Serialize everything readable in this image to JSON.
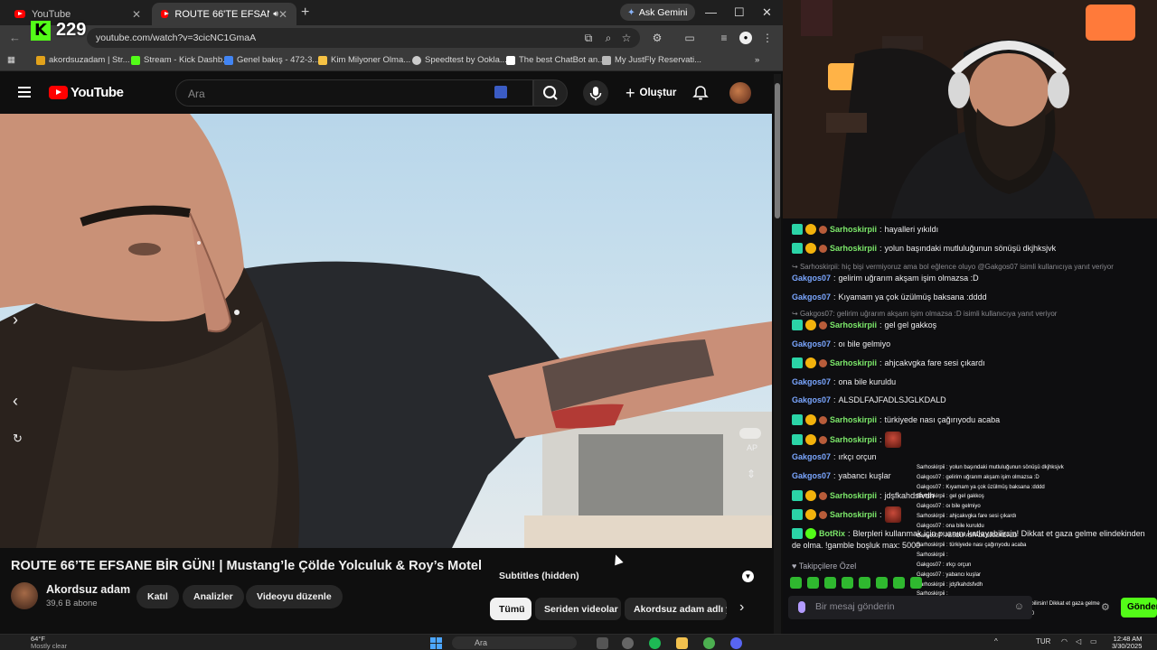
{
  "browser": {
    "tabs": [
      {
        "label": "YouTube"
      },
      {
        "label": "ROUTE 66'TE EFSANE BİR G"
      }
    ],
    "gemini_label": "Ask Gemini",
    "url": "youtube.com/watch?v=3cicNC1GmaA",
    "bookmarks": [
      "akordsuzadam | Str...",
      "Stream - Kick Dashb...",
      "Genel bakış - 472-3...",
      "Kim Milyoner Olma...",
      "Speedtest by Ookla...",
      "The best ChatBot an...",
      "My JustFly Reservati..."
    ]
  },
  "kick_overlay": {
    "viewers": "229"
  },
  "youtube": {
    "logo_text": "YouTube",
    "search_placeholder": "Ara",
    "create_label": "Oluştur",
    "video_title": "ROUTE 66’TE EFSANE BİR GÜN! | Mustang’le Çölde Yolculuk & Roy’s Motel",
    "channel_name": "Akordsuz adam",
    "channel_subs": "39,6 B abone",
    "join_label": "Katıl",
    "analytics_label": "Analizler",
    "edit_label": "Videoyu düzenle",
    "subtitles_label": "Subtitles (hidden)",
    "chips": [
      "Tümü",
      "Seriden videolar",
      "Akordsuz adam adlı y"
    ],
    "video_overlay_label": "AP"
  },
  "chat": {
    "messages": [
      {
        "user": "Sarhoskirpii",
        "text": "hayalleri yıkıldı",
        "style": "green"
      },
      {
        "user": "Sarhoskirpii",
        "text": "yolun başındaki mutluluğunun sönüşü dkjhksjvk",
        "style": "green"
      },
      {
        "reply": "Sarhoskirpii: hiç bişi vermiyoruz ama bol eğlence oluyo @Gakgos07 isimli kullanıcıya yanıt veriyor"
      },
      {
        "user": "Gakgos07",
        "text": "gelirim uğrarım akşam işim olmazsa :D",
        "style": "blue"
      },
      {
        "user": "Gakgos07",
        "text": "Kıyamam ya çok üzülmüş baksana :dddd",
        "style": "blue"
      },
      {
        "reply": "Gakgos07: gelirim uğrarım akşam işim olmazsa :D isimli kullanıcıya yanıt veriyor"
      },
      {
        "user": "Sarhoskirpii",
        "text": "gel gel gakkoş",
        "style": "green"
      },
      {
        "user": "Gakgos07",
        "text": "oı bile gelmiyo",
        "style": "blue"
      },
      {
        "user": "Sarhoskirpii",
        "text": "ahjcakvgka fare sesi çıkardı",
        "style": "green"
      },
      {
        "user": "Gakgos07",
        "text": "ona bile kuruldu",
        "style": "blue"
      },
      {
        "user": "Gakgos07",
        "text": "ALSDLFAJFADLSJGLKDALD",
        "style": "blue"
      },
      {
        "user": "Sarhoskirpii",
        "text": "türkiyede nası çağırıyodu acaba",
        "style": "green"
      },
      {
        "user": "Sarhoskirpii",
        "text": "",
        "style": "green",
        "emote": true
      },
      {
        "user": "Gakgos07",
        "text": "ırkçı orçun",
        "style": "blue"
      },
      {
        "user": "Gakgos07",
        "text": "yabancı kuşlar",
        "style": "blue"
      },
      {
        "user": "Sarhoskirpii",
        "text": "jdşfkahdsfvdh",
        "style": "green"
      },
      {
        "user": "Sarhoskirpii",
        "text": "",
        "style": "green",
        "emote": true
      },
      {
        "user": "BotRix",
        "text": "Blerpleri kullanmak için puanını katlayabilirsin! Dikkat et gaza gelme elindekinden",
        "style": "green"
      },
      {
        "text": "de olma. !gamble boşluk max: 5000"
      }
    ],
    "followers_label": "Takipçilere Özel",
    "input_placeholder": "Bir mesaj gönderin",
    "send_label": "Gönder"
  },
  "overlay_chat": [
    "Sarhoskirpii : yolun başındaki mutluluğunun sönüşü dkjhksjvk",
    "Gakgos07 : gelirim uğrarım akşam işim olmazsa :D",
    "Gakgos07 : Kıyamam ya çok üzülmüş baksana :dddd",
    "Sarhoskirpii : gel gel gakkoş",
    "Gakgos07 : oı bile gelmiyo",
    "Sarhoskirpii : ahjcakvgka fare sesi çıkardı",
    "Gakgos07 : ona bile kuruldu",
    "Gakgos07 : ALSDLFAJFADLSJGLKDALD",
    "Sarhoskirpii : türkiyede nası çağırıyodu acaba",
    "Sarhoskirpii :",
    "Gakgos07 : ırkçı orçun",
    "Gakgos07 : yabancı kuşlar",
    "Sarhoskirpii : jdşfkahdsfvdh",
    "Sarhoskirpii :",
    "BotRix : Blerpleri kullanmak için puanını katlayabilirsin! Dikkat et gaza gelme",
    "elindekinden de olma. !gamble boşluk max: 5000"
  ],
  "taskbar": {
    "weather_temp": "64°F",
    "weather_desc": "Mostly clear",
    "search_label": "Ara",
    "lang": "TUR",
    "time": "12:48 AM",
    "date": "3/30/2025"
  },
  "colors": {
    "kick_green": "#53fc18",
    "youtube_red": "#ff0000",
    "chat_bg": "#0e0e10"
  }
}
